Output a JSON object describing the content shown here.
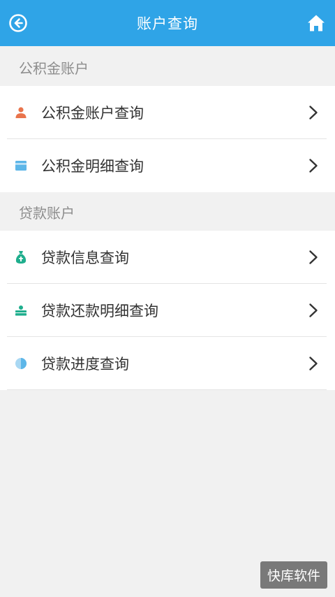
{
  "header": {
    "title": "账户查询",
    "back_icon": "back-arrow-circle-icon",
    "home_icon": "home-icon",
    "background": "#2fa4e7"
  },
  "sections": [
    {
      "label": "公积金账户",
      "items": [
        {
          "label": "公积金账户查询",
          "icon": "person-icon",
          "icon_color": "#e9744c"
        },
        {
          "label": "公积金明细查询",
          "icon": "card-icon",
          "icon_color": "#5db6e8"
        }
      ]
    },
    {
      "label": "贷款账户",
      "items": [
        {
          "label": "贷款信息查询",
          "icon": "money-bag-icon",
          "icon_color": "#1fae8d"
        },
        {
          "label": "贷款还款明细查询",
          "icon": "cash-stack-icon",
          "icon_color": "#1fae8d"
        },
        {
          "label": "贷款进度查询",
          "icon": "pie-progress-icon",
          "icon_color": "#5db6e8"
        }
      ]
    }
  ],
  "watermark": "快库软件"
}
